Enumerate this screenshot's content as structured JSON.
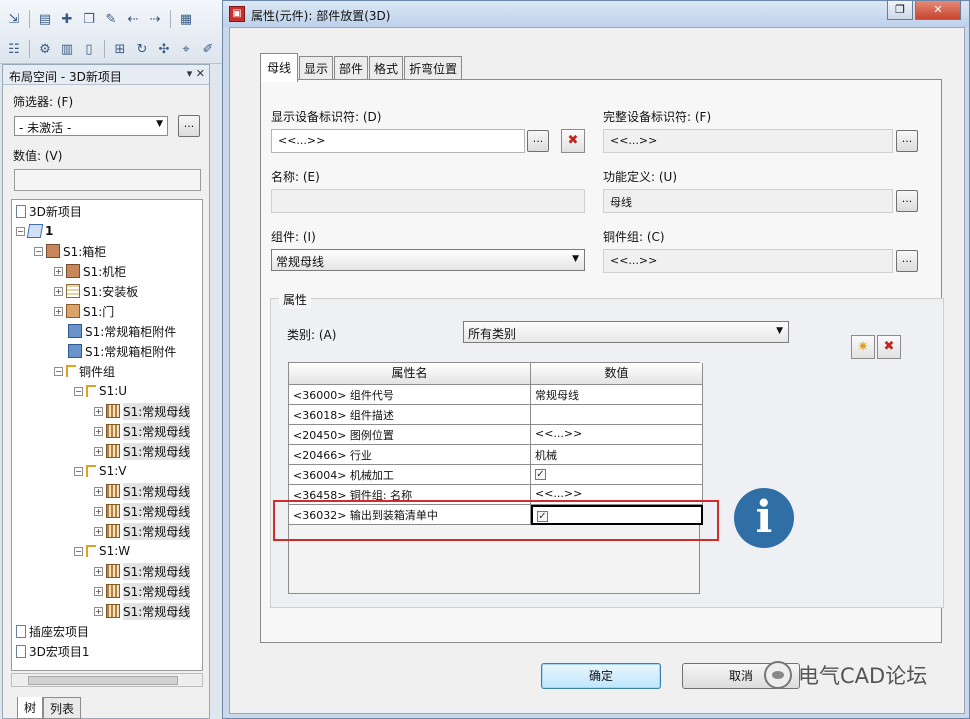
{
  "left_panel": {
    "title": "布局空间 - 3D新项目",
    "title_controls": "▾ ✕",
    "filter_label": "筛选器: (F)",
    "filter_value": "- 未激活 -",
    "value_label": "数值: (V)",
    "dots": "...",
    "tree": [
      {
        "label": "3D新项目",
        "icon": "document-icon"
      },
      {
        "label": "1",
        "icon": "cube-icon"
      },
      {
        "label": "S1:箱柜",
        "icon": "cabinet-icon"
      },
      {
        "label": "S1:机柜",
        "icon": "cabinet-icon"
      },
      {
        "label": "S1:安装板",
        "icon": "mounting-plate-icon"
      },
      {
        "label": "S1:门",
        "icon": "door-icon"
      },
      {
        "label": "S1:常规箱柜附件",
        "icon": "accessory-icon"
      },
      {
        "label": "S1:常规箱柜附件",
        "icon": "accessory-icon"
      },
      {
        "label": "铜件组",
        "icon": "busbar-group-icon"
      },
      {
        "label": "S1:U",
        "icon": "busbar-group-icon"
      },
      {
        "label": "S1:常规母线",
        "icon": "busbar-icon"
      },
      {
        "label": "S1:常规母线",
        "icon": "busbar-icon"
      },
      {
        "label": "S1:常规母线",
        "icon": "busbar-icon"
      },
      {
        "label": "S1:V",
        "icon": "busbar-group-icon"
      },
      {
        "label": "S1:常规母线",
        "icon": "busbar-icon"
      },
      {
        "label": "S1:常规母线",
        "icon": "busbar-icon"
      },
      {
        "label": "S1:常规母线",
        "icon": "busbar-icon"
      },
      {
        "label": "S1:W",
        "icon": "busbar-group-icon"
      },
      {
        "label": "S1:常规母线",
        "icon": "busbar-icon"
      },
      {
        "label": "S1:常规母线",
        "icon": "busbar-icon"
      },
      {
        "label": "S1:常规母线",
        "icon": "busbar-icon"
      },
      {
        "label": "插座宏项目",
        "icon": "document-icon"
      },
      {
        "label": "3D宏项目1",
        "icon": "document-icon"
      }
    ],
    "bottom_tabs": [
      "树",
      "列表"
    ]
  },
  "dialog": {
    "title": "属性(元件): 部件放置(3D)",
    "tabs": [
      "母线",
      "显示",
      "部件",
      "格式",
      "折弯位置"
    ],
    "fields": {
      "display_id_label": "显示设备标识符: (D)",
      "display_id_value": "<<...>>",
      "full_id_label": "完整设备标识符: (F)",
      "full_id_value": "<<...>>",
      "name_label": "名称: (E)",
      "name_value": "",
      "function_label": "功能定义: (U)",
      "function_value": "母线",
      "component_label": "组件: (I)",
      "component_value": "常规母线",
      "copper_group_label": "铜件组: (C)",
      "copper_group_value": "<<...>>"
    },
    "properties_group": "属性",
    "category_label": "类别: (A)",
    "category_value": "所有类别",
    "grid": {
      "headers": [
        "属性名",
        "数值"
      ],
      "rows": [
        {
          "name": "<36000> 组件代号",
          "value": "常规母线",
          "type": "text"
        },
        {
          "name": "<36018> 组件描述",
          "value": "",
          "type": "text"
        },
        {
          "name": "<20450> 图例位置",
          "value": "<<...>>",
          "type": "text"
        },
        {
          "name": "<20466> 行业",
          "value": "机械",
          "type": "text"
        },
        {
          "name": "<36004> 机械加工",
          "value": "✓",
          "type": "check"
        },
        {
          "name": "<36458> 铜件组: 名称",
          "value": "<<...>>",
          "type": "text"
        },
        {
          "name": "<36032> 输出到装箱清单中",
          "value": "✓",
          "type": "check"
        }
      ]
    },
    "ok_label": "确定",
    "cancel_label": "取消",
    "info_glyph": "i"
  },
  "watermark": "电气CAD论坛",
  "colors": {
    "highlight_box": "#d32a2a",
    "info_circle": "#2f6fa6",
    "title_icon": "#c9302c"
  }
}
